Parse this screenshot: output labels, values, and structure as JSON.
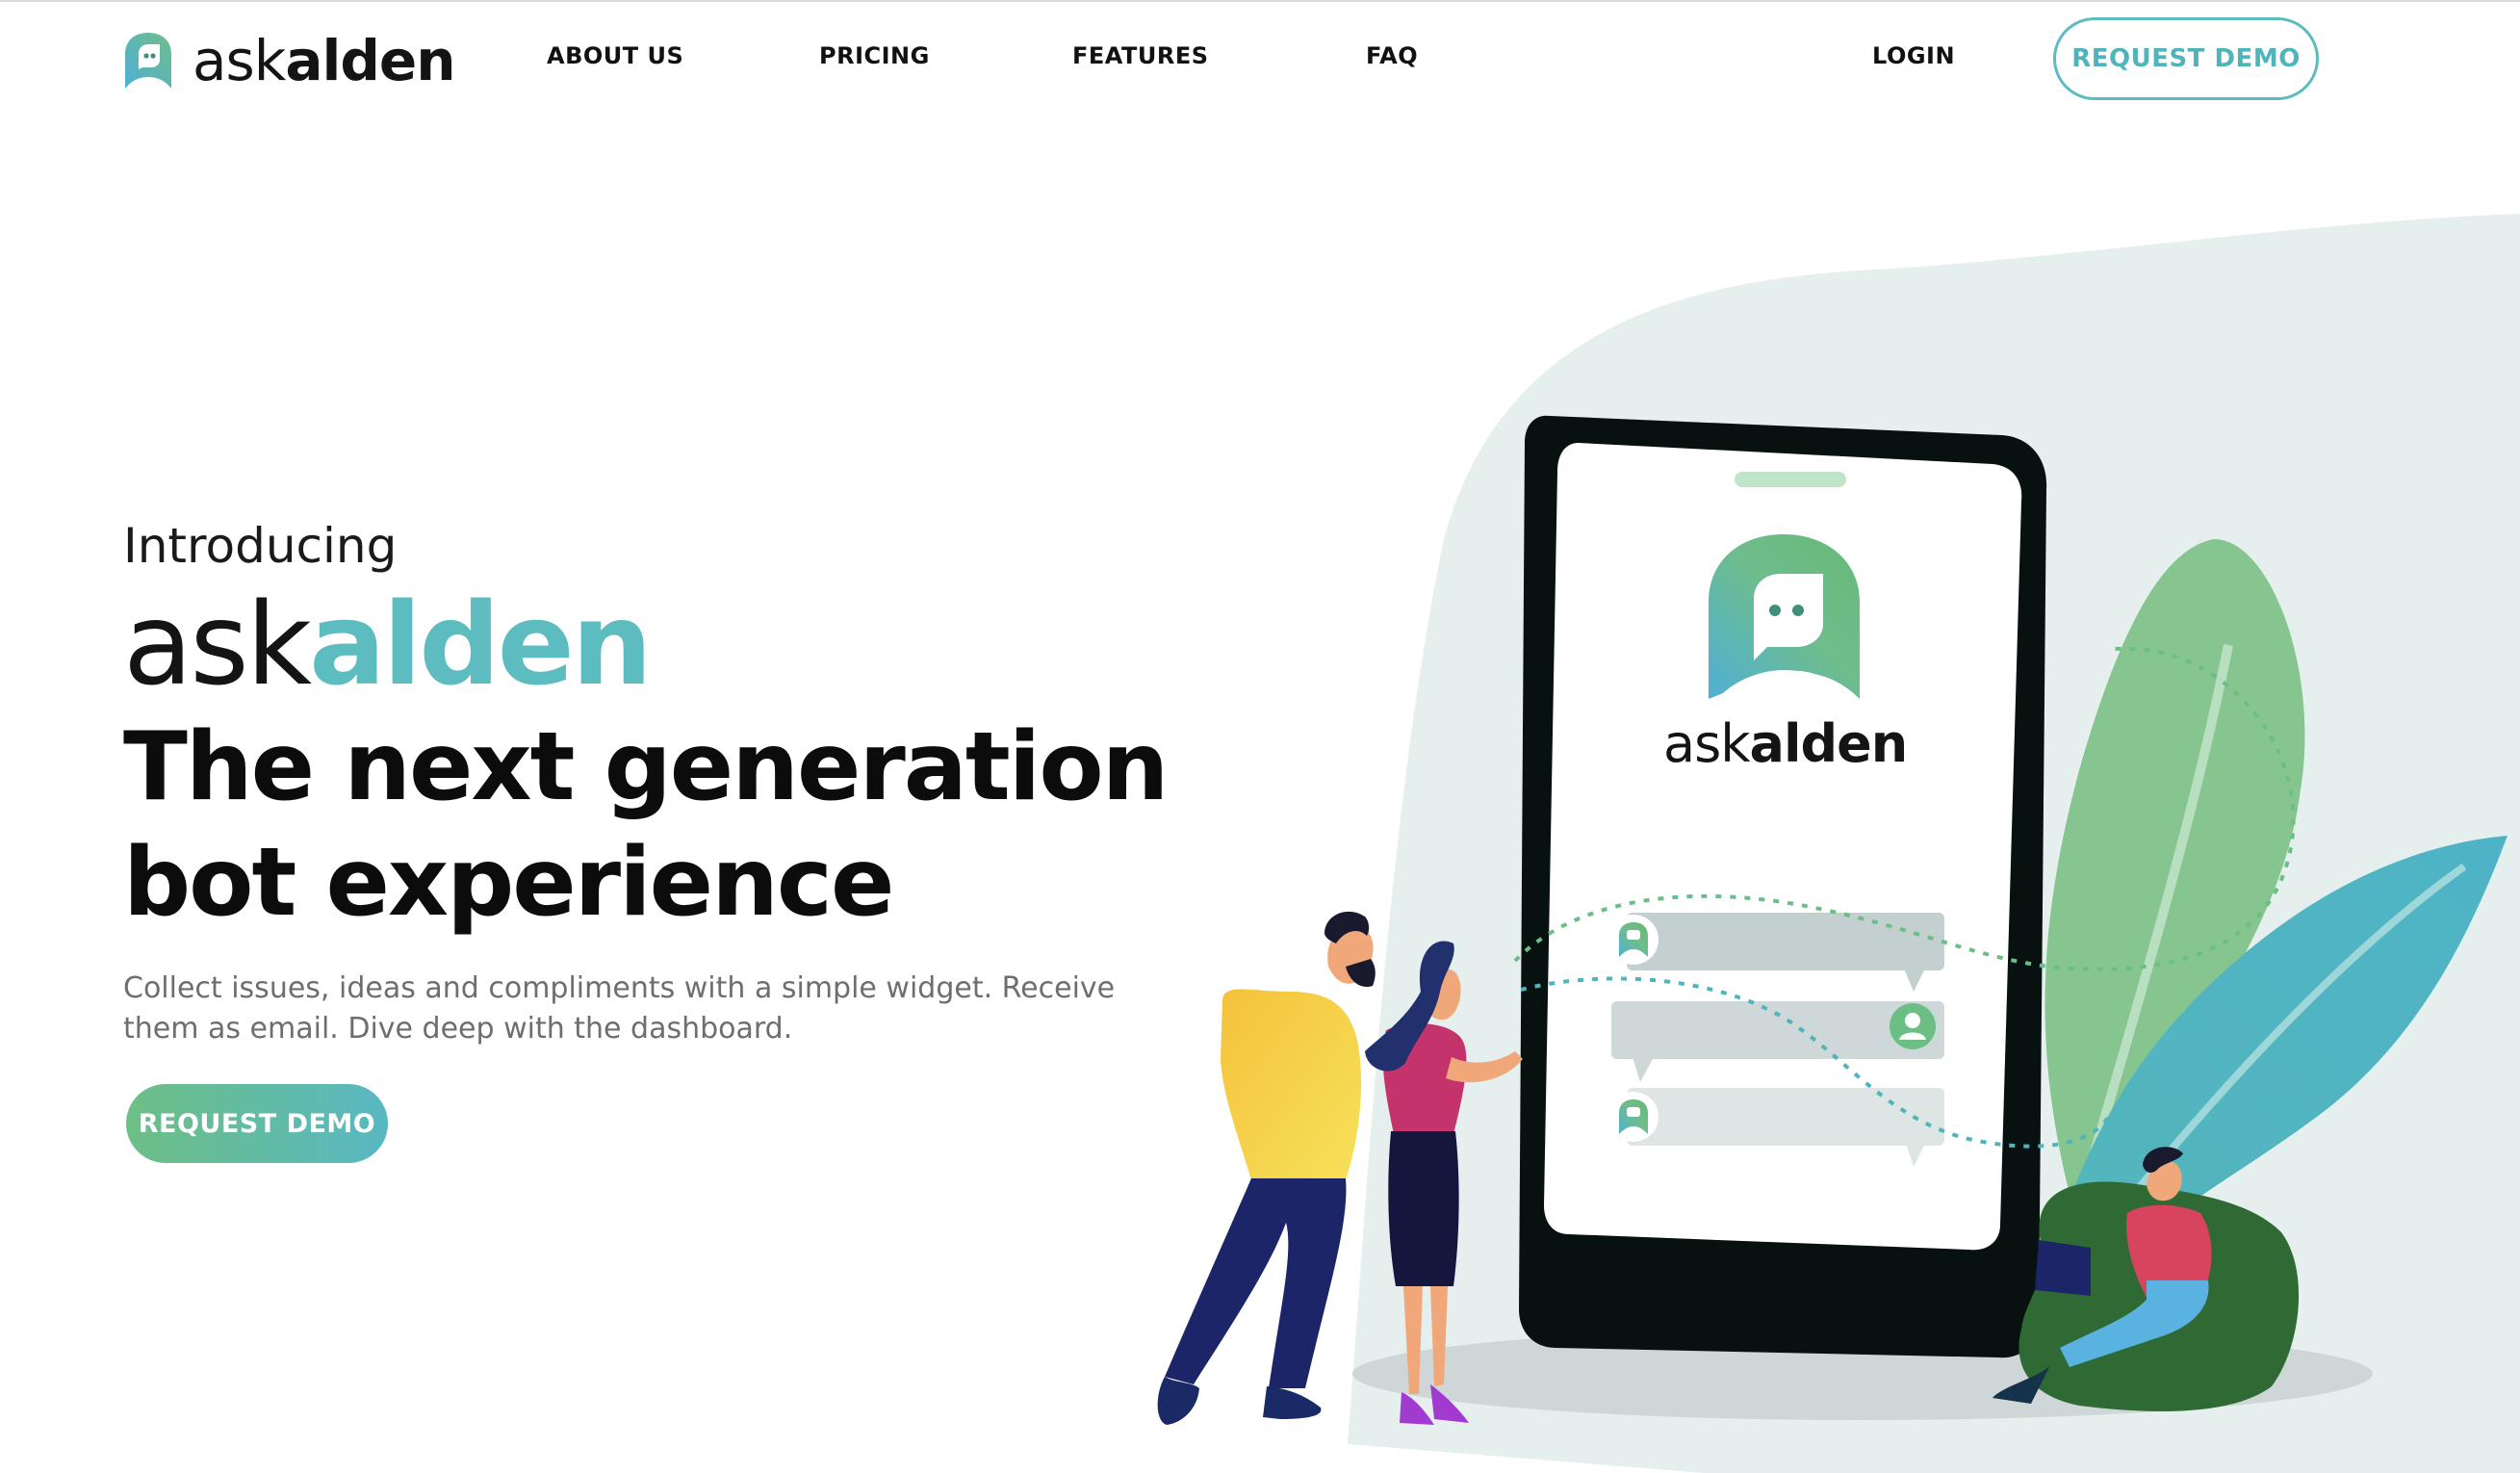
{
  "header": {
    "logo": {
      "ask": "ask",
      "alden": "alden"
    },
    "nav": [
      {
        "label": "ABOUT US"
      },
      {
        "label": "PRICING"
      },
      {
        "label": "FEATURES"
      },
      {
        "label": "FAQ"
      }
    ],
    "login_label": "LOGIN",
    "request_demo_label": "REQUEST DEMO"
  },
  "hero": {
    "intro": "Introducing",
    "brand_ask": "ask",
    "brand_alden": "alden",
    "headline_line1": "The next generation",
    "headline_line2": "bot experience",
    "description": "Collect issues, ideas and compliments with a simple widget. Receive them as email. Dive deep with the dashboard.",
    "cta_label": "REQUEST DEMO"
  },
  "phone": {
    "logo_ask": "ask",
    "logo_alden": "alden"
  },
  "colors": {
    "accent": "#5cbcbf",
    "accent_green": "#6dbf85",
    "phone_frame": "#071210",
    "backdrop": "#e4efee"
  }
}
